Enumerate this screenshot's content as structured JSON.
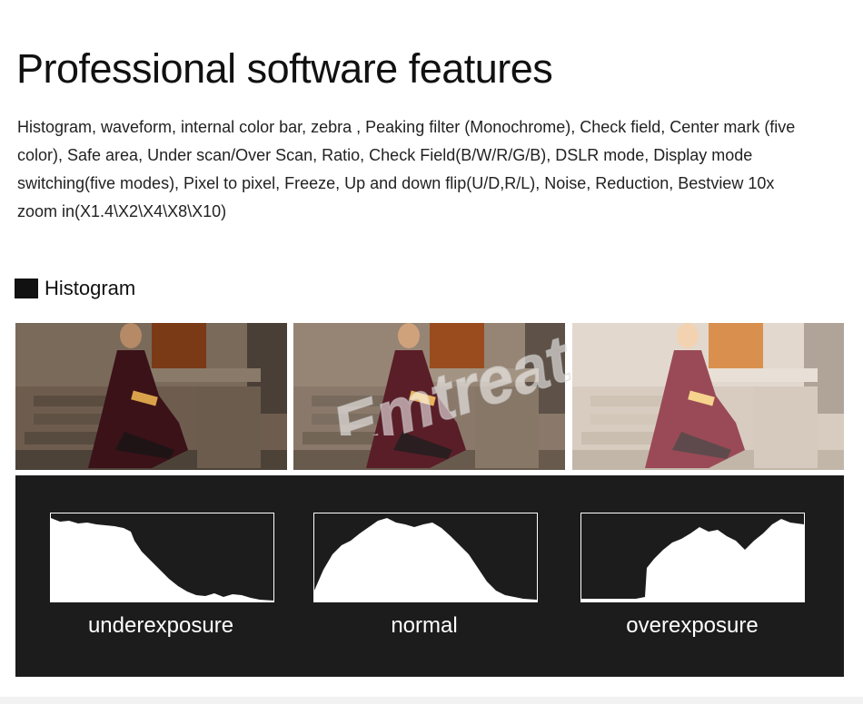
{
  "header": {
    "title": "Professional software features",
    "description": "Histogram, waveform, internal color bar, zebra , Peaking filter (Monochrome), Check field, Center mark (five color), Safe area, Under scan/Over Scan, Ratio, Check Field(B/W/R/G/B), DSLR mode, Display mode switching(five modes), Pixel to pixel, Freeze, Up and down flip(U/D,R/L), Noise, Reduction, Bestview 10x zoom in(X1.4\\X2\\X4\\X8\\X10)"
  },
  "section": {
    "label": "Histogram"
  },
  "watermark": {
    "text": "Emtreat"
  },
  "histograms": [
    {
      "label": "underexposure"
    },
    {
      "label": "normal"
    },
    {
      "label": "overexposure"
    }
  ]
}
